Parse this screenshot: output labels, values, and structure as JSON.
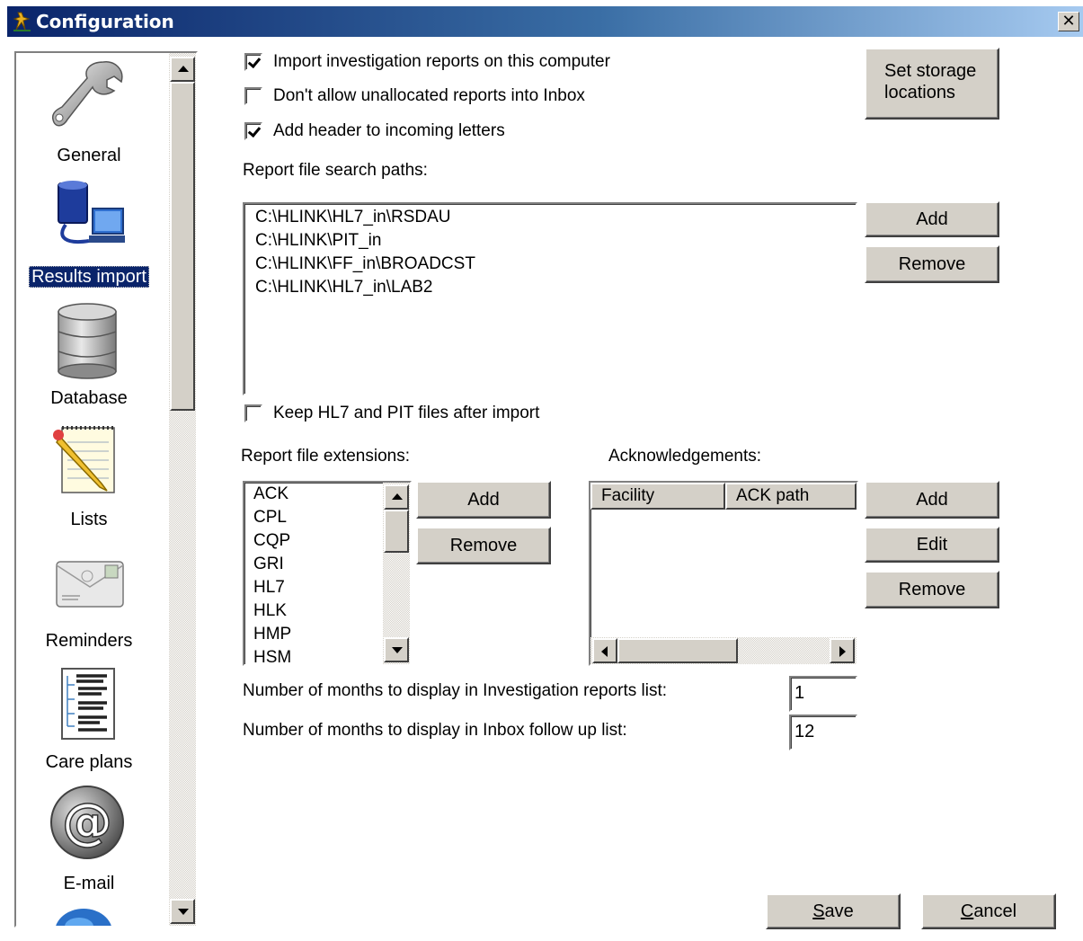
{
  "window": {
    "title": "Configuration"
  },
  "sidebar": {
    "items": [
      {
        "label": "General",
        "icon": "wrench-icon"
      },
      {
        "label": "Results import",
        "icon": "computer-database-icon",
        "selected": true
      },
      {
        "label": "Database",
        "icon": "database-icon"
      },
      {
        "label": "Lists",
        "icon": "notepad-pencil-icon"
      },
      {
        "label": "Reminders",
        "icon": "envelope-icon"
      },
      {
        "label": "Care plans",
        "icon": "document-tree-icon"
      },
      {
        "label": "E-mail",
        "icon": "at-sign-icon"
      }
    ]
  },
  "options": {
    "import_reports": {
      "label": "Import investigation reports on this computer",
      "checked": true
    },
    "no_unallocated": {
      "label": "Don't allow unallocated reports into Inbox",
      "checked": false
    },
    "add_header": {
      "label": "Add header to incoming letters",
      "checked": true
    },
    "keep_files": {
      "label": "Keep HL7 and PIT files after import",
      "checked": false
    }
  },
  "storage_button": {
    "line1": "Set storage",
    "line2": "locations"
  },
  "search_paths": {
    "label": "Report file search paths:",
    "items": [
      "C:\\HLINK\\HL7_in\\RSDAU",
      "C:\\HLINK\\PIT_in",
      "C:\\HLINK\\FF_in\\BROADCST",
      "C:\\HLINK\\HL7_in\\LAB2"
    ],
    "add_label": "Add",
    "remove_label": "Remove"
  },
  "extensions": {
    "label": "Report file extensions:",
    "items": [
      "ACK",
      "CPL",
      "CQP",
      "GRI",
      "HL7",
      "HLK",
      "HMP",
      "HSM"
    ],
    "add_label": "Add",
    "remove_label": "Remove"
  },
  "acknowledgements": {
    "label": "Acknowledgements:",
    "columns": [
      "Facility",
      "ACK path"
    ],
    "add_label": "Add",
    "edit_label": "Edit",
    "remove_label": "Remove"
  },
  "months": {
    "investigation_label": "Number of months to display in Investigation reports list:",
    "investigation_value": "1",
    "inbox_label": "Number of months to display in Inbox follow up list:",
    "inbox_value": "12"
  },
  "footer": {
    "save_first": "S",
    "save_rest": "ave",
    "cancel_first": "C",
    "cancel_rest": "ancel"
  }
}
